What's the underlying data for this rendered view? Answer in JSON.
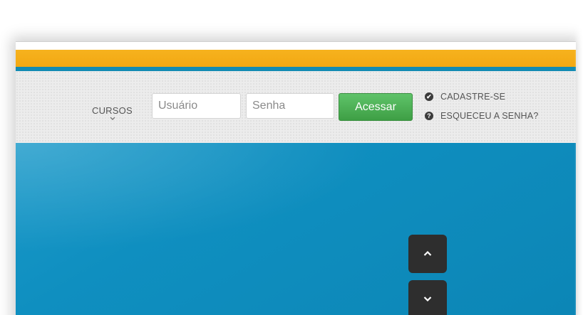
{
  "header": {
    "accent_color": "#f3a812",
    "line_color": "#138bb3"
  },
  "login_bar": {
    "menu_label": "CURSOS",
    "menu_icon": "chevron-down-icon",
    "username_placeholder": "Usuário",
    "password_placeholder": "Senha",
    "submit_label": "Acessar",
    "submit_color": "#4cae55",
    "links": {
      "register": "CADASTRE-SE",
      "register_icon": "check-circle-icon",
      "forgot": "ESQUECEU A SENHA?",
      "forgot_icon": "question-circle-icon"
    }
  },
  "hero": {
    "background_color": "#0f8fc0",
    "scroll_up_icon": "chevron-up-icon",
    "scroll_down_icon": "chevron-down-icon"
  }
}
